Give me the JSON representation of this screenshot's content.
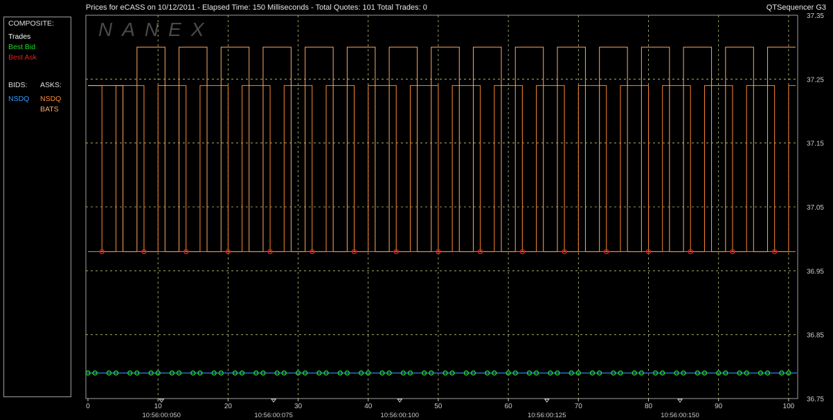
{
  "header": {
    "title": "Prices for  eCASS  on  10/12/2011  -  Elapsed Time: 150 Milliseconds  -  Total Quotes: 101  Total Trades: 0",
    "app": "QTSequencer G3"
  },
  "watermark": "NANEX",
  "legend": {
    "composite_label": "COMPOSITE:",
    "trades": "Trades",
    "best_bid": "Best Bid",
    "best_ask": "Best Ask",
    "bids_label": "BIDS:",
    "asks_label": "ASKS:",
    "bid_exchanges": [
      "NSDQ"
    ],
    "ask_exchanges": [
      "NSDQ",
      "BATS"
    ]
  },
  "colors": {
    "background": "#000000",
    "trades": "#ffffff",
    "best_bid": "#22dd22",
    "best_ask": "#dd2222",
    "bid_nsdq": "#3399ff",
    "ask_nsdq": "#ff8833",
    "ask_bats": "#ffaa66",
    "grid": "#c8c87a",
    "axis": "#cccccc"
  },
  "chart_data": {
    "type": "line",
    "xlim": [
      0,
      101
    ],
    "ylim": [
      36.75,
      37.35
    ],
    "x_ticks": [
      0,
      10,
      20,
      30,
      40,
      50,
      60,
      70,
      80,
      90,
      100
    ],
    "y_ticks": [
      "36.75",
      "36.85",
      "36.95",
      "37.05",
      "37.15",
      "37.25",
      "37.35"
    ],
    "grid": true,
    "time_labels": [
      {
        "x": 10.5,
        "label": "10:56:00:050"
      },
      {
        "x": 26.5,
        "label": "10:56:00:075"
      },
      {
        "x": 44.5,
        "label": "10:56:00:100"
      },
      {
        "x": 65.5,
        "label": "10:56:00:125"
      },
      {
        "x": 84.5,
        "label": "10:56:00:150"
      }
    ],
    "bid": {
      "name": "NSDQ",
      "price": 36.79
    },
    "ask_levels": {
      "low": 36.98,
      "mid": 37.24,
      "high": 37.3
    },
    "ask_cycle_period": 6,
    "ask_cycle_start": 2,
    "best_ask_markers": [
      2,
      8,
      14,
      20,
      26,
      32,
      38,
      44,
      50,
      56,
      62,
      68,
      74,
      80,
      86,
      92,
      98
    ],
    "best_bid_pairs": [
      0,
      3,
      6,
      9,
      12,
      15,
      18,
      21,
      24,
      27,
      30,
      33,
      36,
      39,
      42,
      45,
      48,
      51,
      54,
      57,
      60,
      63,
      66,
      69,
      72,
      75,
      78,
      81,
      84,
      87,
      90,
      93,
      96,
      99
    ]
  }
}
